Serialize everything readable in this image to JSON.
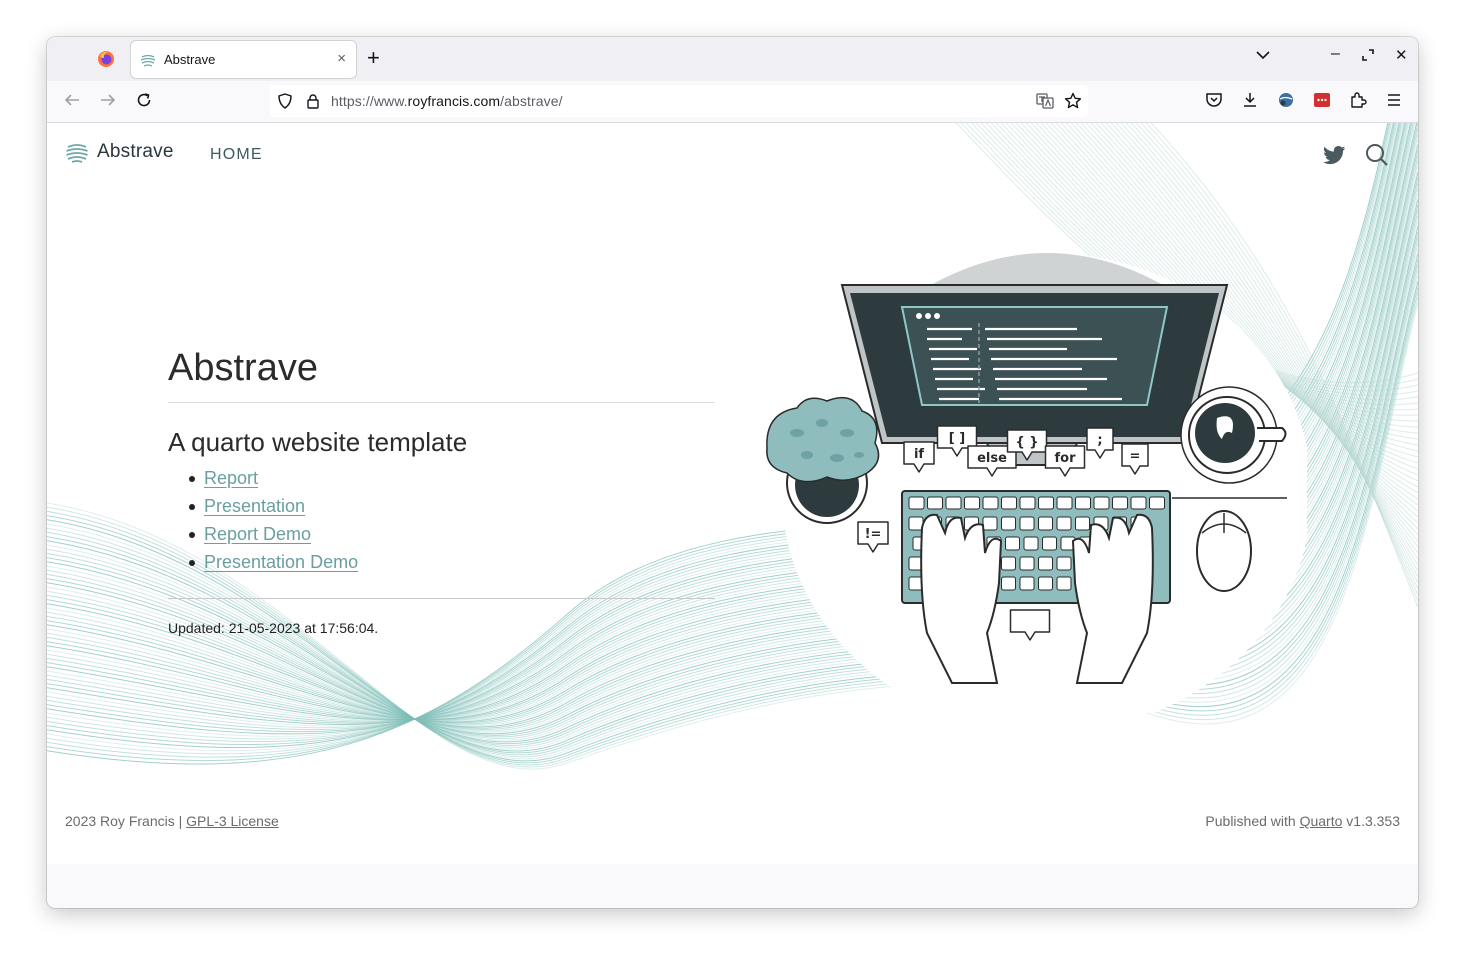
{
  "browser": {
    "tab_title": "Abstrave",
    "new_tab": "+",
    "close_tab": "×",
    "url_prefix": "https://www.",
    "url_host": "royfrancis.com",
    "url_path": "/abstrave/"
  },
  "site": {
    "brand": "Abstrave",
    "nav_home": "HOME"
  },
  "content": {
    "title": "Abstrave",
    "subtitle": "A quarto website template",
    "links": [
      "Report",
      "Presentation",
      "Report Demo",
      "Presentation Demo"
    ],
    "updated": "Updated: 21-05-2023 at 17:56:04."
  },
  "illustration": {
    "bubbles": [
      "if",
      "[ ]",
      "else",
      "{ }",
      "for",
      ";",
      "=",
      "!=",
      "</>"
    ]
  },
  "footer": {
    "left_text": "2023 Roy Francis | ",
    "license_link": "GPL-3 License",
    "right_prefix": "Published with ",
    "quarto_link": "Quarto",
    "right_suffix": " v1.3.353"
  },
  "colors": {
    "accent": "#6a9ea0",
    "wave": "#7fbfb8",
    "screen": "#2d3b3e"
  }
}
